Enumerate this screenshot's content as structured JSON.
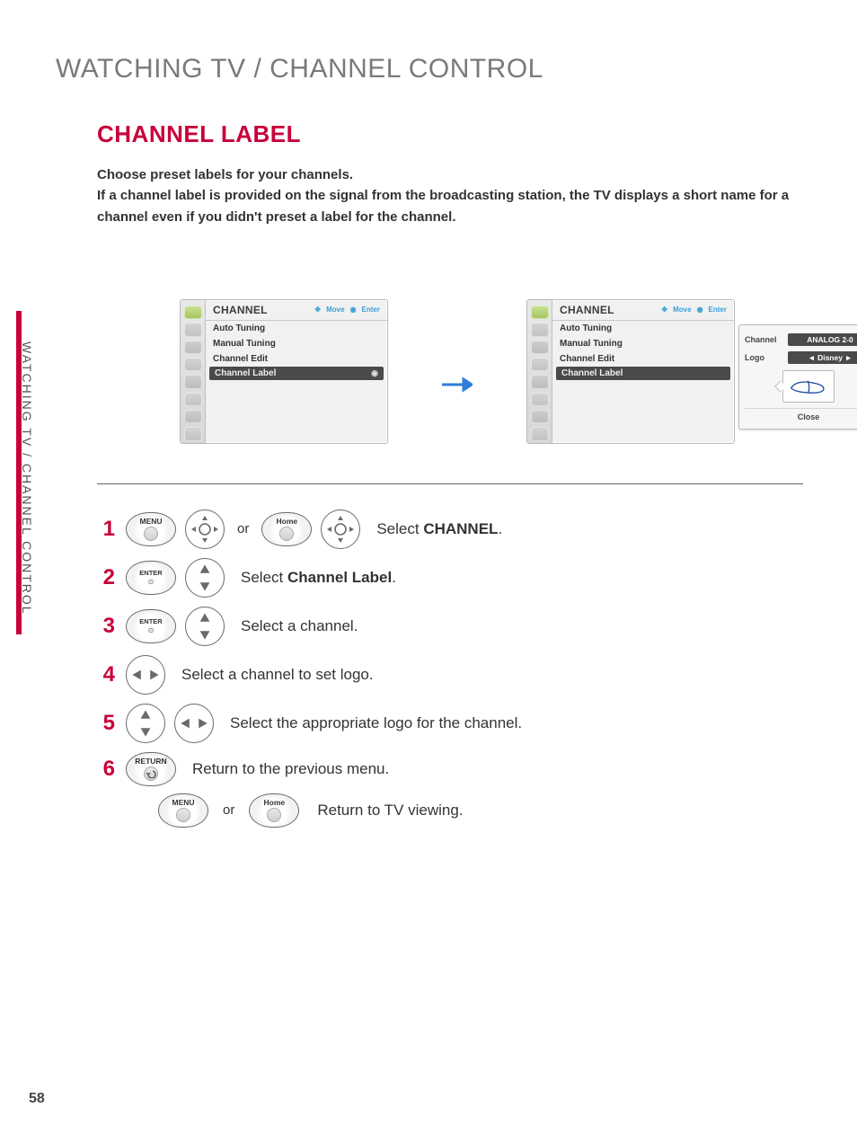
{
  "side_label": "WATCHING TV / CHANNEL CONTROL",
  "page_number": "58",
  "section_title": "WATCHING TV / CHANNEL CONTROL",
  "subtitle": "CHANNEL LABEL",
  "intro_line1": "Choose preset labels for your channels.",
  "intro_line2": "If a channel label is provided on the signal from the broadcasting station, the TV displays a short name for a channel even if you didn't preset a label for the channel.",
  "osd": {
    "header_title": "CHANNEL",
    "hint_move": "Move",
    "hint_enter": "Enter",
    "items": [
      "Auto Tuning",
      "Manual Tuning",
      "Channel Edit",
      "Channel Label"
    ],
    "selected_index": 3
  },
  "popup": {
    "row_channel_label": "Channel",
    "row_channel_value": "ANALOG 2-0",
    "row_logo_label": "Logo",
    "row_logo_value": "Disney",
    "close": "Close"
  },
  "buttons": {
    "menu": "MENU",
    "home": "Home",
    "enter": "ENTER",
    "return": "RETURN"
  },
  "or_text": "or",
  "steps": {
    "s1": {
      "num": "1",
      "text_pre": "Select ",
      "text_bold": "CHANNEL",
      "text_post": "."
    },
    "s2": {
      "num": "2",
      "text_pre": "Select ",
      "text_bold": "Channel Label",
      "text_post": "."
    },
    "s3": {
      "num": "3",
      "text": "Select a channel."
    },
    "s4": {
      "num": "4",
      "text": "Select a channel to set logo."
    },
    "s5": {
      "num": "5",
      "text": "Select the appropriate logo for the channel."
    },
    "s6": {
      "num": "6",
      "text_return": "Return to the previous menu.",
      "text_tv": "Return to TV viewing."
    }
  }
}
